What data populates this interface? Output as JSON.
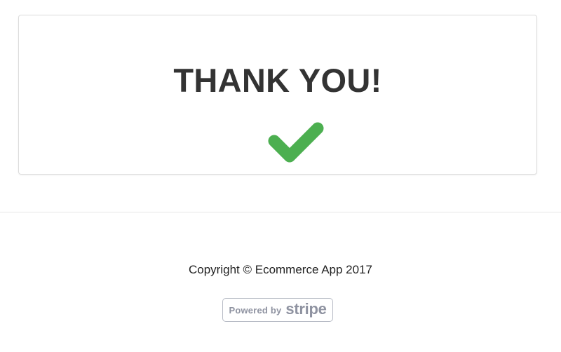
{
  "confirmation": {
    "title": "THANK YOU!",
    "icon": "checkmark-icon",
    "icon_color": "#4caf50"
  },
  "footer": {
    "copyright": "Copyright © Ecommerce App 2017",
    "badge": {
      "powered_label": "Powered by",
      "brand": "stripe",
      "color": "#8f93a1"
    }
  }
}
